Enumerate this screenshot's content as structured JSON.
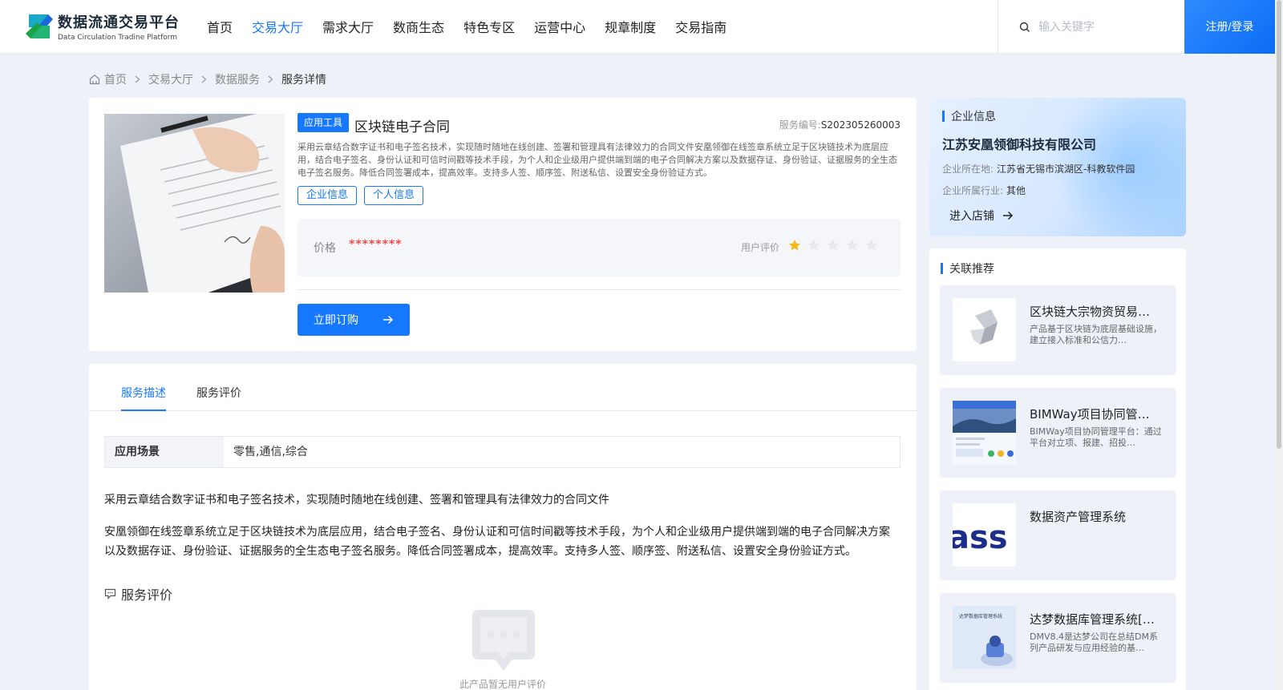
{
  "header": {
    "logo_title": "数据流通交易平台",
    "logo_subtitle": "Data Circulation Tradine Platform",
    "nav": [
      {
        "label": "首页",
        "active": false
      },
      {
        "label": "交易大厅",
        "active": true
      },
      {
        "label": "需求大厅",
        "active": false
      },
      {
        "label": "数商生态",
        "active": false
      },
      {
        "label": "特色专区",
        "active": false
      },
      {
        "label": "运营中心",
        "active": false
      },
      {
        "label": "规章制度",
        "active": false
      },
      {
        "label": "交易指南",
        "active": false
      }
    ],
    "search_placeholder": "输入关键字",
    "login_label": "注册/登录"
  },
  "breadcrumb": [
    "首页",
    "交易大厅",
    "数据服务",
    "服务详情"
  ],
  "product": {
    "tag": "应用工具",
    "title": "区块链电子合同",
    "service_no_label": "服务编号:",
    "service_no": "S202305260003",
    "description": "采用云章结合数字证书和电子签名技术，实现随时随地在线创建、签署和管理具有法律效力的合同文件安凰领御在线签章系统立足于区块链技术为底层应用，结合电子签名、身份认证和可信时间戳等技术手段，为个人和企业级用户提供端到端的电子合同解决方案以及数据存证、身份验证、证据服务的全生态电子签名服务。降低合同签署成本，提高效率。支持多人签、顺序签、附送私信、设置安全身份验证方式。",
    "info_tags": [
      "企业信息",
      "个人信息"
    ],
    "price_label": "价格",
    "price_value": "********",
    "rating_label": "用户评价",
    "rating": 1,
    "rating_max": 5,
    "buy_label": "立即订购"
  },
  "detail": {
    "tabs": [
      {
        "label": "服务描述",
        "active": true
      },
      {
        "label": "服务评价",
        "active": false
      }
    ],
    "scene_key": "应用场景",
    "scene_value": "零售,通信,综合",
    "paragraph1": "采用云章结合数字证书和电子签名技术，实现随时随地在线创建、签署和管理具有法律效力的合同文件",
    "paragraph2": "安凰领御在线签章系统立足于区块链技术为底层应用，结合电子签名、身份认证和可信时间戳等技术手段，为个人和企业级用户提供端到端的电子合同解决方案以及数据存证、身份验证、证据服务的全生态电子签名服务。降低合同签署成本，提高效率。支持多人签、顺序签、附送私信、设置安全身份验证方式。",
    "review_title": "服务评价",
    "empty_text": "此产品暂无用户评价"
  },
  "company": {
    "section_title": "企业信息",
    "name": "江苏安凰领御科技有限公司",
    "location_label": "企业所在地:",
    "location": "江苏省无锡市滨湖区-科教软件园",
    "industry_label": "企业所属行业:",
    "industry": "其他",
    "shop_label": "进入店铺"
  },
  "recommend": {
    "section_title": "关联推荐",
    "items": [
      {
        "title": "区块链大宗物资贸易…",
        "desc": "产品基于区块链为底层基础设施，建立接入标准和公信力…"
      },
      {
        "title": "BIMWay项目协同管…",
        "desc": "BIMWay项目协同管理平台：通过平台对立项、报建、招投…"
      },
      {
        "title": "数据资产管理系统",
        "desc": "",
        "thumb_text": "ass"
      },
      {
        "title": "达梦数据库管理系统[…",
        "desc": "DMV8.4是达梦公司在总结DM系列产品研发与应用经验的基…",
        "thumb_text": "达梦数据库管理系统"
      }
    ]
  },
  "colors": {
    "accent": "#1677ff",
    "price": "#f04848",
    "star": "#f5b719",
    "page_bg": "#eef1f7"
  }
}
